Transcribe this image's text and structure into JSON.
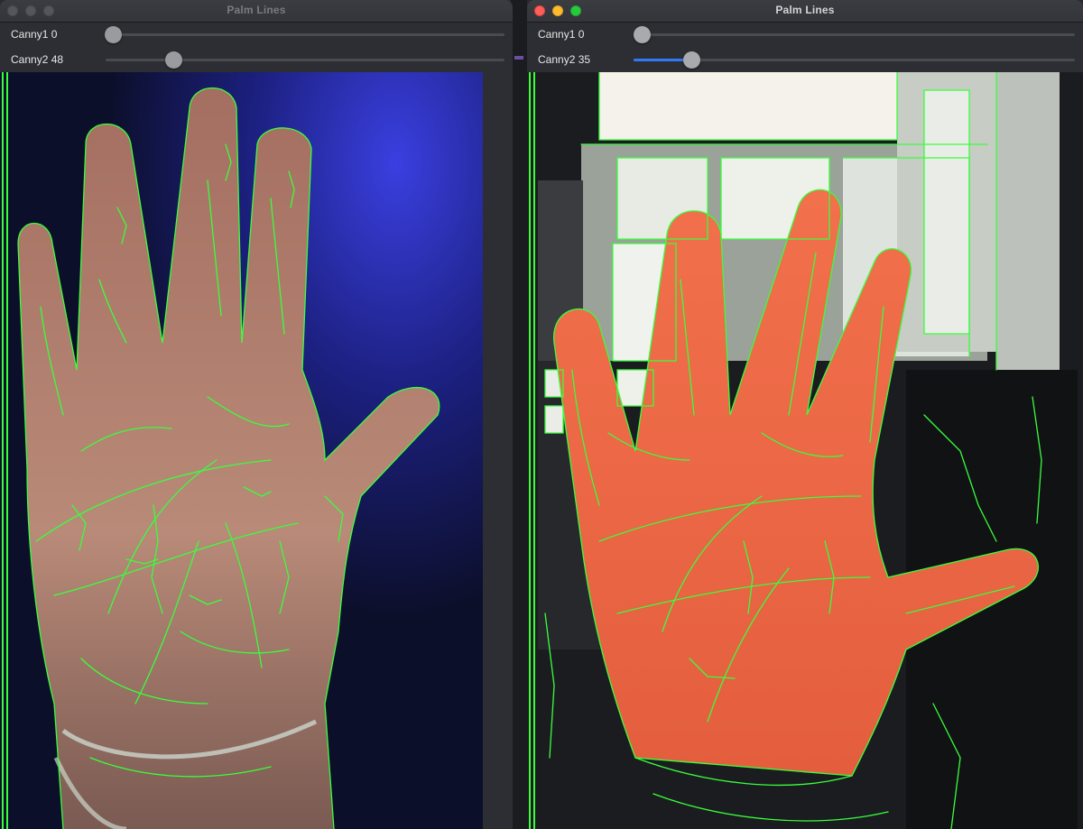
{
  "windows": [
    {
      "title": "Palm Lines",
      "active": false,
      "sliders": [
        {
          "name": "Canny1",
          "value": 0,
          "label": "Canny1 0",
          "fraction": 0.0
        },
        {
          "name": "Canny2",
          "value": 48,
          "label": "Canny2 48",
          "fraction": 0.17
        }
      ]
    },
    {
      "title": "Palm Lines",
      "active": true,
      "sliders": [
        {
          "name": "Canny1",
          "value": 0,
          "label": "Canny1 0",
          "fraction": 0.0
        },
        {
          "name": "Canny2",
          "value": 35,
          "label": "Canny2 35",
          "fraction": 0.13
        }
      ]
    }
  ],
  "colors": {
    "edge": "#39ff3c",
    "accent": "#2f7bf5",
    "left_background": "#1e2a8a",
    "left_skin": "#b07e6e",
    "right_skin": "#ee6a48"
  }
}
